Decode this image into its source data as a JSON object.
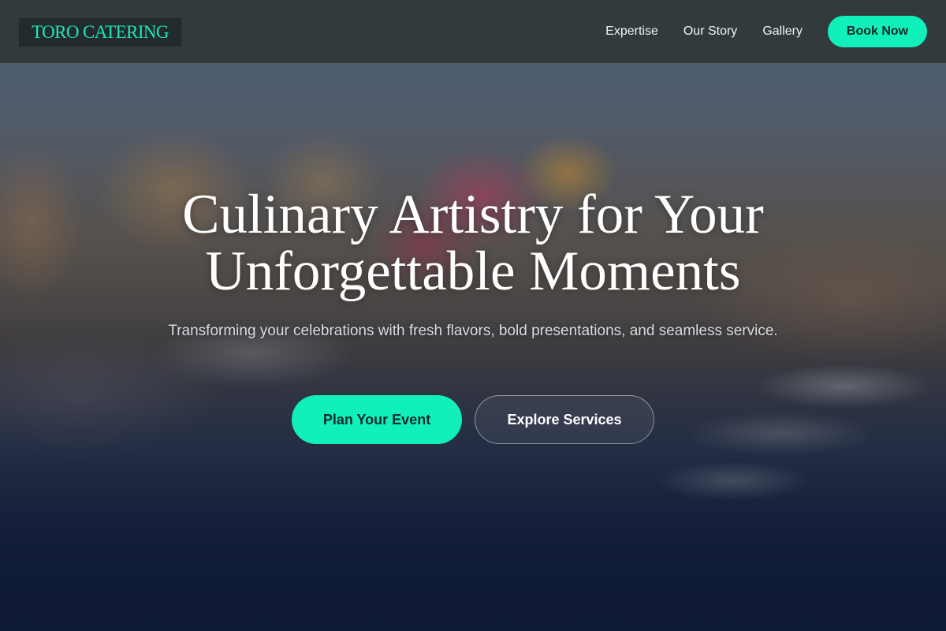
{
  "brand": {
    "name": "TORO CATERING"
  },
  "nav": {
    "links": [
      {
        "label": "Expertise"
      },
      {
        "label": "Our Story"
      },
      {
        "label": "Gallery"
      }
    ],
    "cta_label": "Book Now"
  },
  "hero": {
    "title_line1": "Culinary Artistry for Your",
    "title_line2": "Unforgettable Moments",
    "subtitle": "Transforming your celebrations with fresh flavors, bold presentations, and seamless service.",
    "primary_cta": "Plan Your Event",
    "secondary_cta": "Explore Services"
  },
  "colors": {
    "accent": "#11f0bb",
    "brand_text": "#1ee8b2",
    "navbar_bg": "#30383a",
    "hero_bottom": "#101a34"
  }
}
